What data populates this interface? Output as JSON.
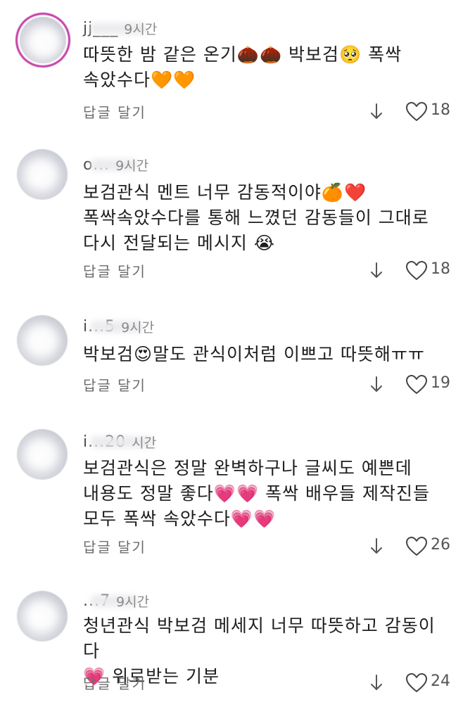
{
  "comments": [
    {
      "username": "jj___",
      "time": "9시간",
      "text_parts": [
        "따뜻한 밤 같은 온기",
        "[chestnut][chestnut]",
        " 박보검",
        "[pleading]",
        " 폭싹\n속았수다",
        "[orange-heart][orange-heart]"
      ],
      "text": "따뜻한 밤 같은 온기🌰🌰 박보검🥺 폭싹\n속았수다🧡🧡",
      "reply_label": "답글 달기",
      "likes": "18"
    },
    {
      "username": "o...",
      "time": "9시간",
      "text": "보검관식 멘트  너무 감동적이야🍊❤️\n폭싹속았수다를 통해 느꼈던 감동들이 그대로\n다시 전달되는 메시지 😭",
      "reply_label": "답글 달기",
      "likes": "18"
    },
    {
      "username": "i...5",
      "time": "9시간",
      "text": "박보검😍말도 관식이처럼 이쁘고 따뜻해ㅠㅠ",
      "reply_label": "답글 달기",
      "likes": "19"
    },
    {
      "username": "i...20",
      "time": "시간",
      "text": "보검관식은 정말 완벽하구나 글씨도 예쁜데\n내용도 정말 좋다💗💗 폭싹 배우들 제작진들\n모두 폭싹 속았수다💗💗",
      "reply_label": "답글 달기",
      "likes": "26"
    },
    {
      "username": "...7",
      "time": "9시간",
      "text": "청년관식 박보검 메세지 너무 따뜻하고 감동이다\n💗 위로받는 기분",
      "reply_label": "답글 달기",
      "likes": "24"
    }
  ],
  "icons": {
    "downvote": "arrow-down-icon",
    "like": "heart-outline-icon"
  },
  "colors": {
    "story_ring": "#c33aa6",
    "meta_text": "#6b6b6b"
  }
}
